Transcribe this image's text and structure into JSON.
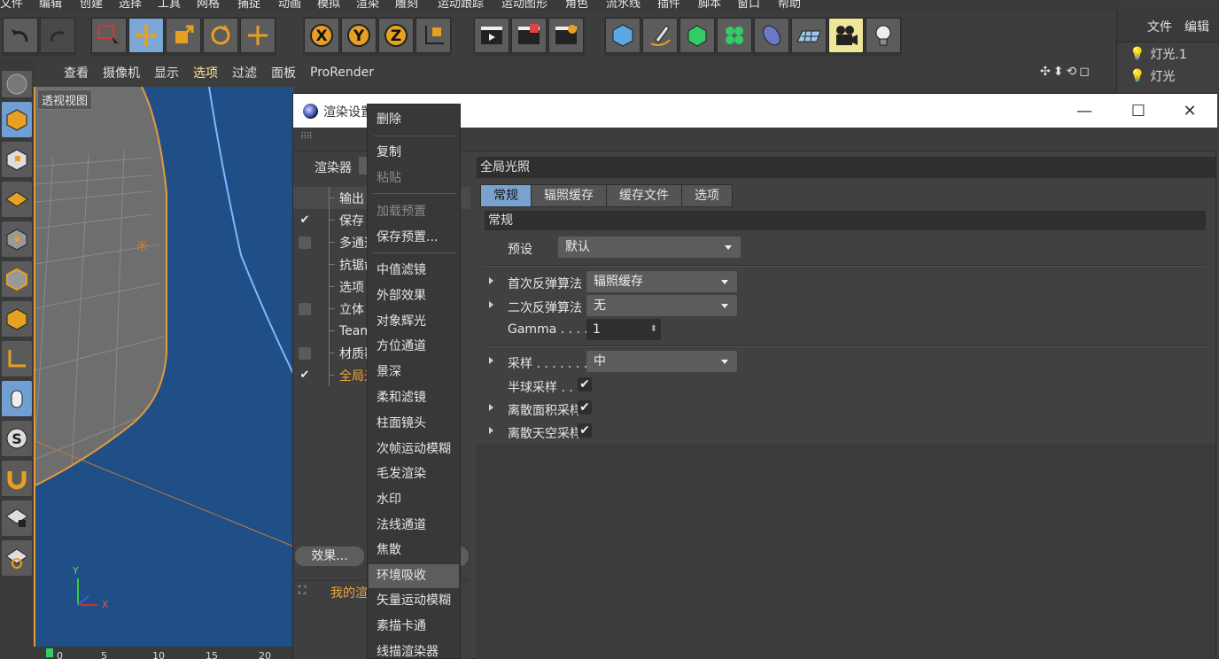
{
  "menubar": [
    "文件",
    "编辑",
    "创建",
    "选择",
    "工具",
    "网格",
    "捕捉",
    "动画",
    "模拟",
    "渲染",
    "雕刻",
    "运动跟踪",
    "运动图形",
    "角色",
    "流水线",
    "插件",
    "脚本",
    "窗口",
    "帮助"
  ],
  "object_manager": {
    "tabs": [
      "文件",
      "编辑"
    ],
    "objects": [
      "灯光.1",
      "灯光"
    ]
  },
  "viewport": {
    "menu": [
      "查看",
      "摄像机",
      "显示",
      "选项",
      "过滤",
      "面板",
      "ProRender"
    ],
    "active_menu": "选项",
    "view_label": "透视视图",
    "axis_x": "X",
    "axis_y": "Y",
    "timeline_ticks": [
      "0",
      "5",
      "10",
      "15",
      "20"
    ]
  },
  "render_window": {
    "title": "渲染设置",
    "controls": {
      "minimize": "—",
      "maximize": "☐",
      "close": "✕"
    },
    "renderer_label": "渲染器",
    "tree": [
      {
        "label": "输出",
        "check": ""
      },
      {
        "label": "保存",
        "check": "✔"
      },
      {
        "label": "多通道",
        "check": "box"
      },
      {
        "label": "抗锯齿",
        "check": ""
      },
      {
        "label": "选项",
        "check": ""
      },
      {
        "label": "立体",
        "check": "box"
      },
      {
        "label": "Team Render",
        "check": ""
      },
      {
        "label": "材质覆写",
        "check": "box"
      },
      {
        "label": "全局光照",
        "check": "✔"
      }
    ],
    "effect_button": "效果...",
    "preset_name": "我的渲染设置",
    "section_title": "全局光照",
    "tabs": [
      "常规",
      "辐照缓存",
      "缓存文件",
      "选项"
    ],
    "active_tab": "常规",
    "subsection": "常规",
    "preset_label": "预设",
    "preset_value": "默认",
    "primary_label": "首次反弹算法",
    "primary_value": "辐照缓存",
    "secondary_label": "二次反弹算法",
    "secondary_value": "无",
    "gamma_label": "Gamma . . . .",
    "gamma_value": "1",
    "sampling_label": "采样 . . . . . . .",
    "sampling_value": "中",
    "hemi_label": "半球采样 . . . .",
    "discrete_area_label": "离散面积采样",
    "discrete_sky_label": "离散天空采样",
    "check_mark": "✔"
  },
  "context_menu": {
    "items": [
      {
        "label": "删除",
        "state": "normal"
      },
      {
        "label": "复制",
        "state": "normal"
      },
      {
        "label": "粘贴",
        "state": "disabled"
      },
      {
        "label": "加载预置",
        "state": "disabled"
      },
      {
        "label": "保存预置...",
        "state": "normal"
      },
      {
        "label": "中值滤镜",
        "state": "normal"
      },
      {
        "label": "外部效果",
        "state": "normal"
      },
      {
        "label": "对象辉光",
        "state": "normal"
      },
      {
        "label": "方位通道",
        "state": "normal"
      },
      {
        "label": "景深",
        "state": "normal"
      },
      {
        "label": "柔和滤镜",
        "state": "normal"
      },
      {
        "label": "柱面镜头",
        "state": "normal"
      },
      {
        "label": "次帧运动模糊",
        "state": "normal"
      },
      {
        "label": "毛发渲染",
        "state": "normal"
      },
      {
        "label": "水印",
        "state": "normal"
      },
      {
        "label": "法线通道",
        "state": "normal"
      },
      {
        "label": "焦散",
        "state": "normal"
      },
      {
        "label": "环境吸收",
        "state": "highlighted"
      },
      {
        "label": "矢量运动模糊",
        "state": "normal"
      },
      {
        "label": "素描卡通",
        "state": "normal"
      },
      {
        "label": "线描渲染器",
        "state": "normal"
      }
    ]
  },
  "colors": {
    "accent_blue": "#7aa2cf",
    "highlight_yellow": "#eee79a",
    "orange_text": "#f0a63a"
  }
}
